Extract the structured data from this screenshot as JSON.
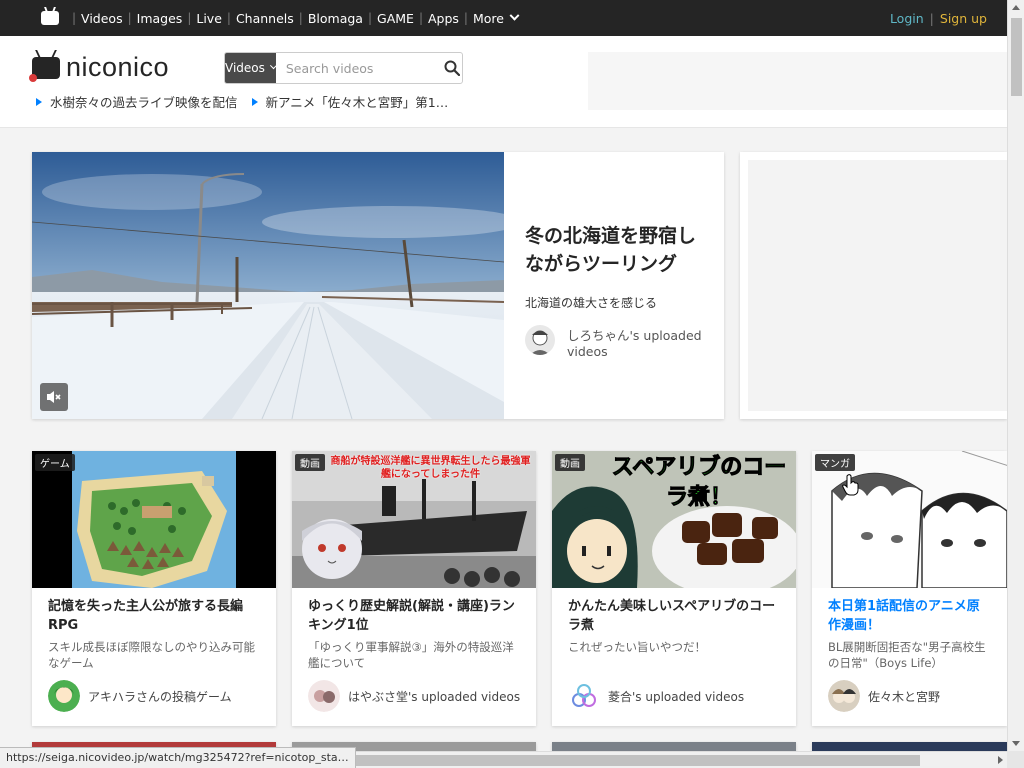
{
  "topnav": {
    "links": [
      "Videos",
      "Images",
      "Live",
      "Channels",
      "Blomaga",
      "GAME",
      "Apps"
    ],
    "more": "More",
    "login": "Login",
    "signup": "Sign up"
  },
  "header": {
    "logo": "niconico",
    "search": {
      "category": "Videos",
      "placeholder": "Search videos"
    },
    "news": [
      "水樹奈々の過去ライブ映像を配信",
      "新アニメ「佐々木と宮野」第1…"
    ]
  },
  "hero": {
    "title": "冬の北海道を野宿しながらツーリング",
    "subtitle": "北海道の雄大さを感じる",
    "user": "しろちゃん's uploaded videos"
  },
  "cards": [
    {
      "tag": "ゲーム",
      "title": "記憶を失った主人公が旅する長編RPG",
      "desc": "スキル成長ほぼ際限なしのやり込み可能なゲーム",
      "user": "アキハラさんの投稿ゲーム",
      "title_color": "#252525"
    },
    {
      "tag": "動画",
      "title": "ゆっくり歴史解説(解説・講座)ランキング1位",
      "desc": "「ゆっくり軍事解説③」海外の特設巡洋艦について",
      "user": "はやぶさ堂's uploaded videos",
      "title_color": "#252525",
      "thumb_text": "商船が特設巡洋艦に異世界転生したら最強軍艦になってしまった件"
    },
    {
      "tag": "動画",
      "title": "かんたん美味しいスペアリブのコーラ煮",
      "desc": "これぜったい旨いやつだ！",
      "user": "菱合's uploaded videos",
      "title_color": "#252525",
      "thumb_text": "スペアリブのコーラ煮！"
    },
    {
      "tag": "マンガ",
      "title": "本日第1話配信のアニメ原作漫画！",
      "desc": "BL展開断固拒否な\"男子高校生の日常\"（Boys Life）",
      "user": "佐々木と宮野",
      "title_color": "#0080ff"
    }
  ],
  "status_url": "https://seiga.nicovideo.jp/watch/mg325472?ref=nicotop_sta…",
  "colors": {
    "topnav_bg": "#252525",
    "login": "#5fb7c6",
    "signup": "#dfb43a",
    "accent_blue": "#0080ff"
  }
}
